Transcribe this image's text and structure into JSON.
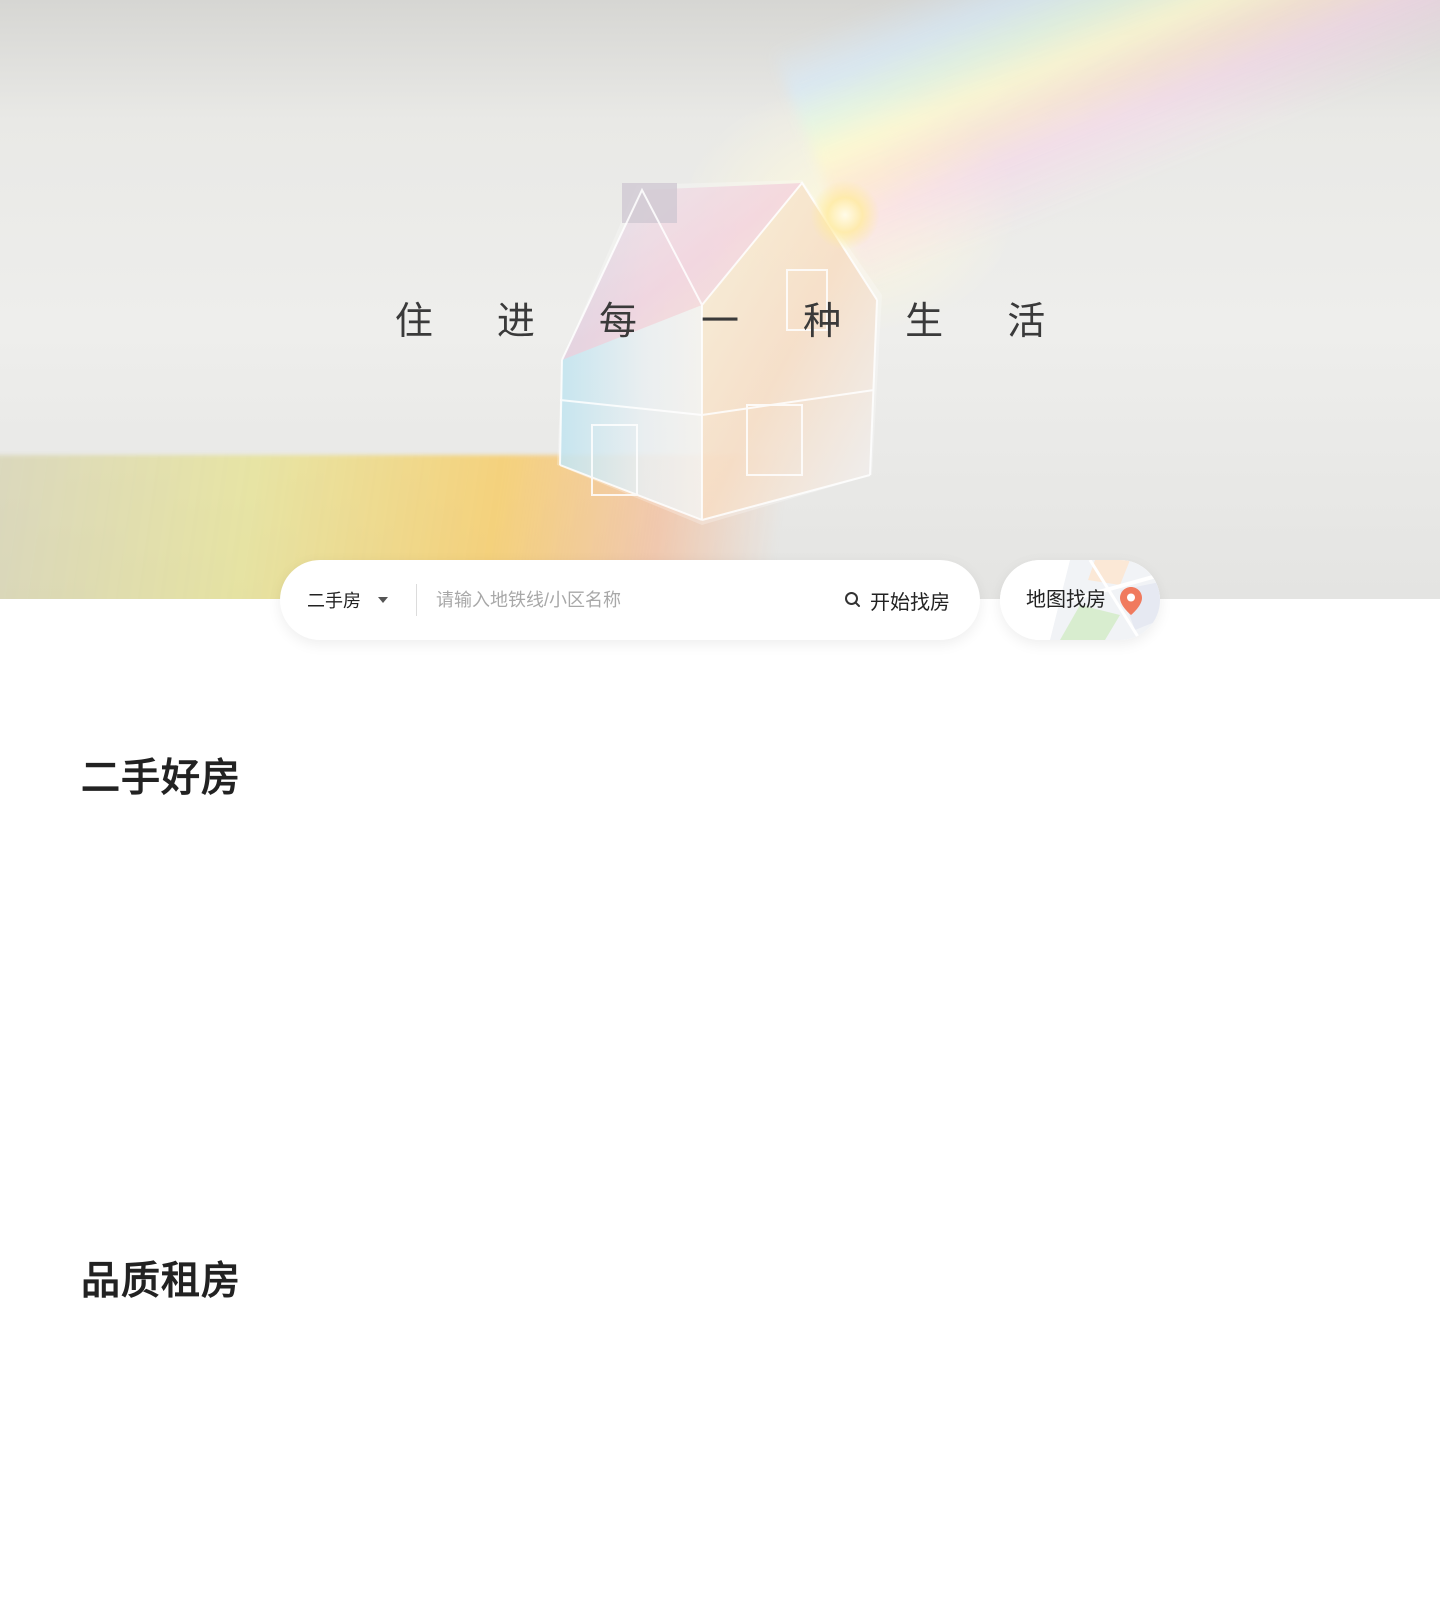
{
  "hero": {
    "slogan": "住 进 每 一 种 生 活"
  },
  "search": {
    "type_label": "二手房",
    "placeholder": "请输入地铁线/小区名称",
    "value": "",
    "button_label": "开始找房"
  },
  "map_search": {
    "label": "地图找房",
    "icon": "map-pin-icon",
    "pin_color": "#f07a5e"
  },
  "sections": {
    "secondhand_title": "二手好房",
    "rental_title": "品质租房"
  },
  "colors": {
    "text_primary": "#222222",
    "placeholder": "#a8a8a8"
  }
}
